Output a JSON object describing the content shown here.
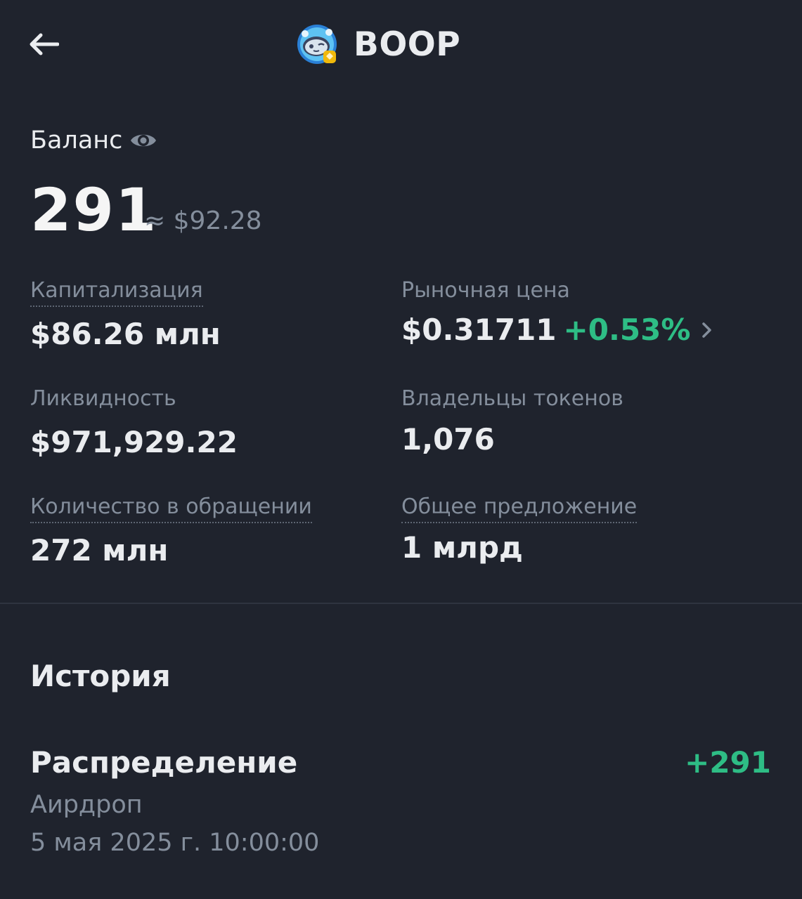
{
  "header": {
    "title": "BOOP",
    "back_icon": "arrow-left-icon",
    "logo_icon": "boop-token-logo"
  },
  "balance": {
    "label": "Баланс",
    "visibility_icon": "eye-icon",
    "amount": "291",
    "usd_value": "≈ $92.28"
  },
  "stats": {
    "market_cap": {
      "label": "Капитализация",
      "value": "$86.26 млн"
    },
    "market_price": {
      "label": "Рыночная цена",
      "value": "$0.31711",
      "change": "+0.53%"
    },
    "liquidity": {
      "label": "Ликвидность",
      "value": "$971,929.22"
    },
    "holders": {
      "label": "Владельцы токенов",
      "value": "1,076"
    },
    "circulating_supply": {
      "label": "Количество в обращении",
      "value": "272 млн"
    },
    "total_supply": {
      "label": "Общее предложение",
      "value": "1 млрд"
    }
  },
  "history": {
    "title": "История",
    "items": [
      {
        "title": "Распределение",
        "type": "Аирдроп",
        "date": "5 мая 2025 г. 10:00:00",
        "amount": "+291"
      }
    ]
  },
  "colors": {
    "background": "#1f232d",
    "primary_text": "#eaecef",
    "secondary_text": "#848e9c",
    "positive": "#2ebd85",
    "divider": "#2f3440"
  }
}
